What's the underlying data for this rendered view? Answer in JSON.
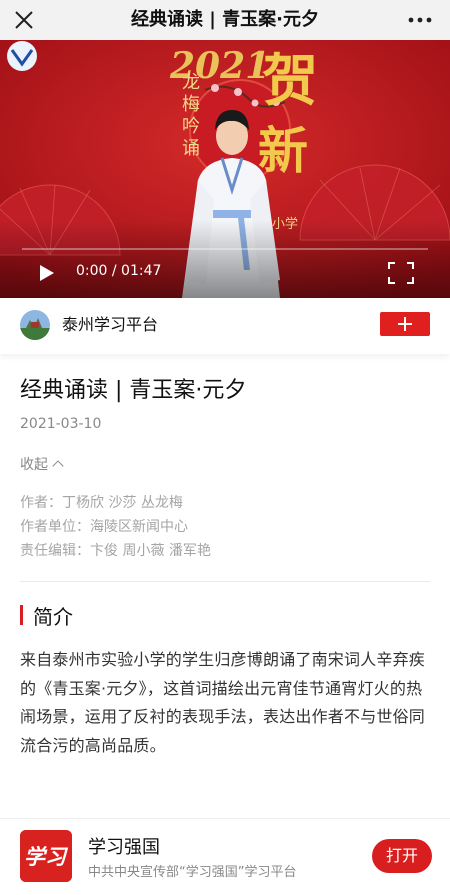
{
  "topbar": {
    "title": "经典诵读 | 青玉案·元夕"
  },
  "video": {
    "time_current": "00:00",
    "time_total": "01:47",
    "time_display": "0:00 / 01:47",
    "progress": 0.0,
    "overlay_text": {
      "year": "2021",
      "blessing_1": "贺",
      "blessing_2": "新",
      "vertical": "龙梅吟诵",
      "school": "小学"
    }
  },
  "account": {
    "name": "泰州学习平台"
  },
  "article": {
    "title": "经典诵读 | 青玉案·元夕",
    "date": "2021-03-10",
    "collapse_label": "收起",
    "meta": [
      {
        "label": "作者：",
        "value": "丁杨欣 沙莎 丛龙梅"
      },
      {
        "label": "作者单位：",
        "value": "海陵区新闻中心"
      },
      {
        "label": "责任编辑：",
        "value": "卞俊 周小薇 潘军艳"
      }
    ],
    "section_title": "简介",
    "summary": "来自泰州市实验小学的学生归彦博朗诵了南宋词人辛弃疾的《青玉案·元夕》，这首词描绘出元宵佳节通宵灯火的热闹场景，运用了反衬的表现手法，表达出作者不与世俗同流合污的高尚品质。"
  },
  "bottom_bar": {
    "app_name": "学习强国",
    "app_desc": "中共中央宣传部“学习强国”学习平台",
    "open_label": "打开",
    "logo_text": "学习"
  },
  "colors": {
    "accent": "#d81e1e",
    "video_bg": "#b8141c",
    "topbar_bg": "#f2f2f2"
  }
}
